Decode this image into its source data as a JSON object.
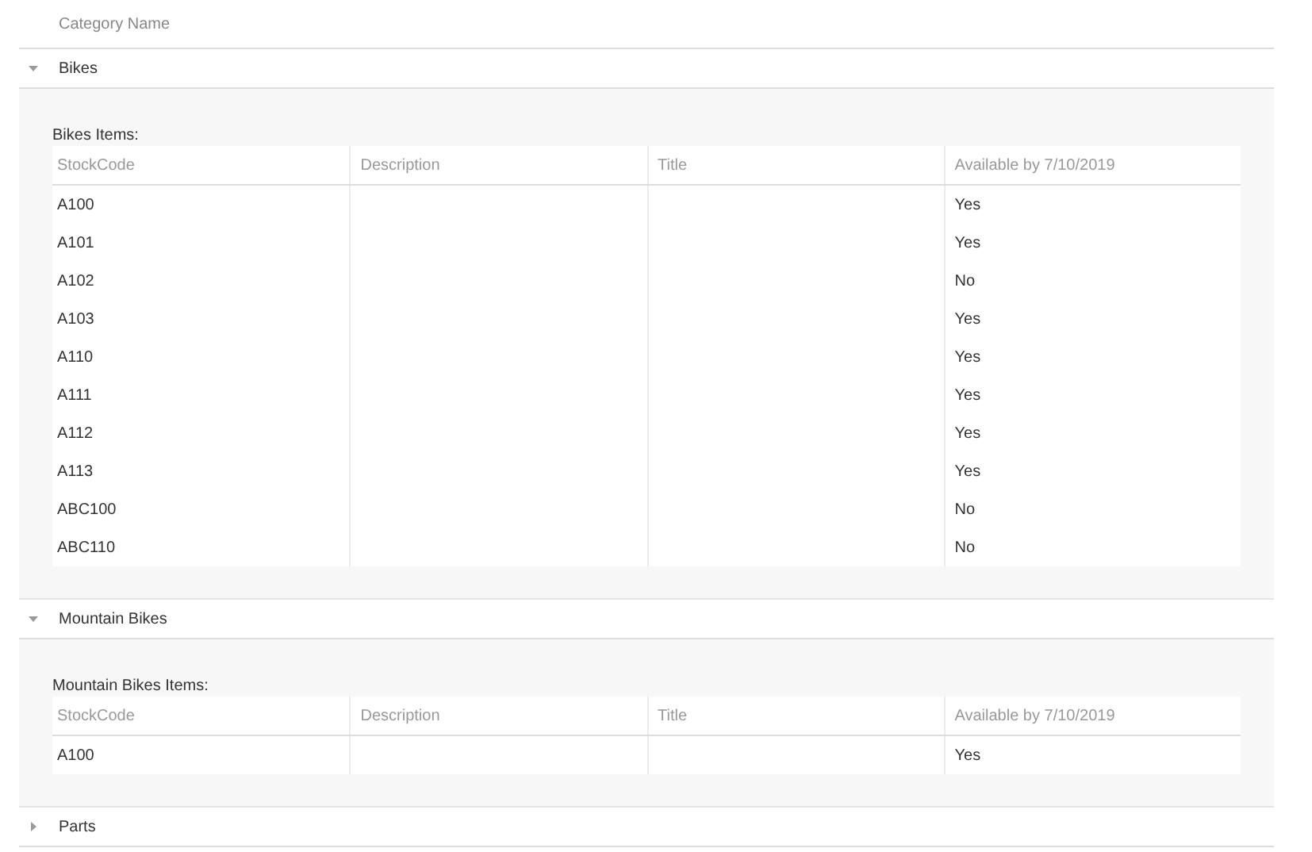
{
  "grid": {
    "column_header": "Category Name",
    "groups": [
      {
        "name": "Bikes",
        "expanded": true,
        "detail": {
          "caption": "Bikes Items:",
          "columns": [
            "StockCode",
            "Description",
            "Title",
            "Available by 7/10/2019"
          ],
          "rows": [
            [
              "A100",
              "",
              "",
              "Yes"
            ],
            [
              "A101",
              "",
              "",
              "Yes"
            ],
            [
              "A102",
              "",
              "",
              "No"
            ],
            [
              "A103",
              "",
              "",
              "Yes"
            ],
            [
              "A110",
              "",
              "",
              "Yes"
            ],
            [
              "A111",
              "",
              "",
              "Yes"
            ],
            [
              "A112",
              "",
              "",
              "Yes"
            ],
            [
              "A113",
              "",
              "",
              "Yes"
            ],
            [
              "ABC100",
              "",
              "",
              "No"
            ],
            [
              "ABC110",
              "",
              "",
              "No"
            ]
          ]
        }
      },
      {
        "name": "Mountain Bikes",
        "expanded": true,
        "detail": {
          "caption": "Mountain Bikes Items:",
          "columns": [
            "StockCode",
            "Description",
            "Title",
            "Available by 7/10/2019"
          ],
          "rows": [
            [
              "A100",
              "",
              "",
              "Yes"
            ]
          ]
        }
      },
      {
        "name": "Parts",
        "expanded": false
      }
    ]
  }
}
